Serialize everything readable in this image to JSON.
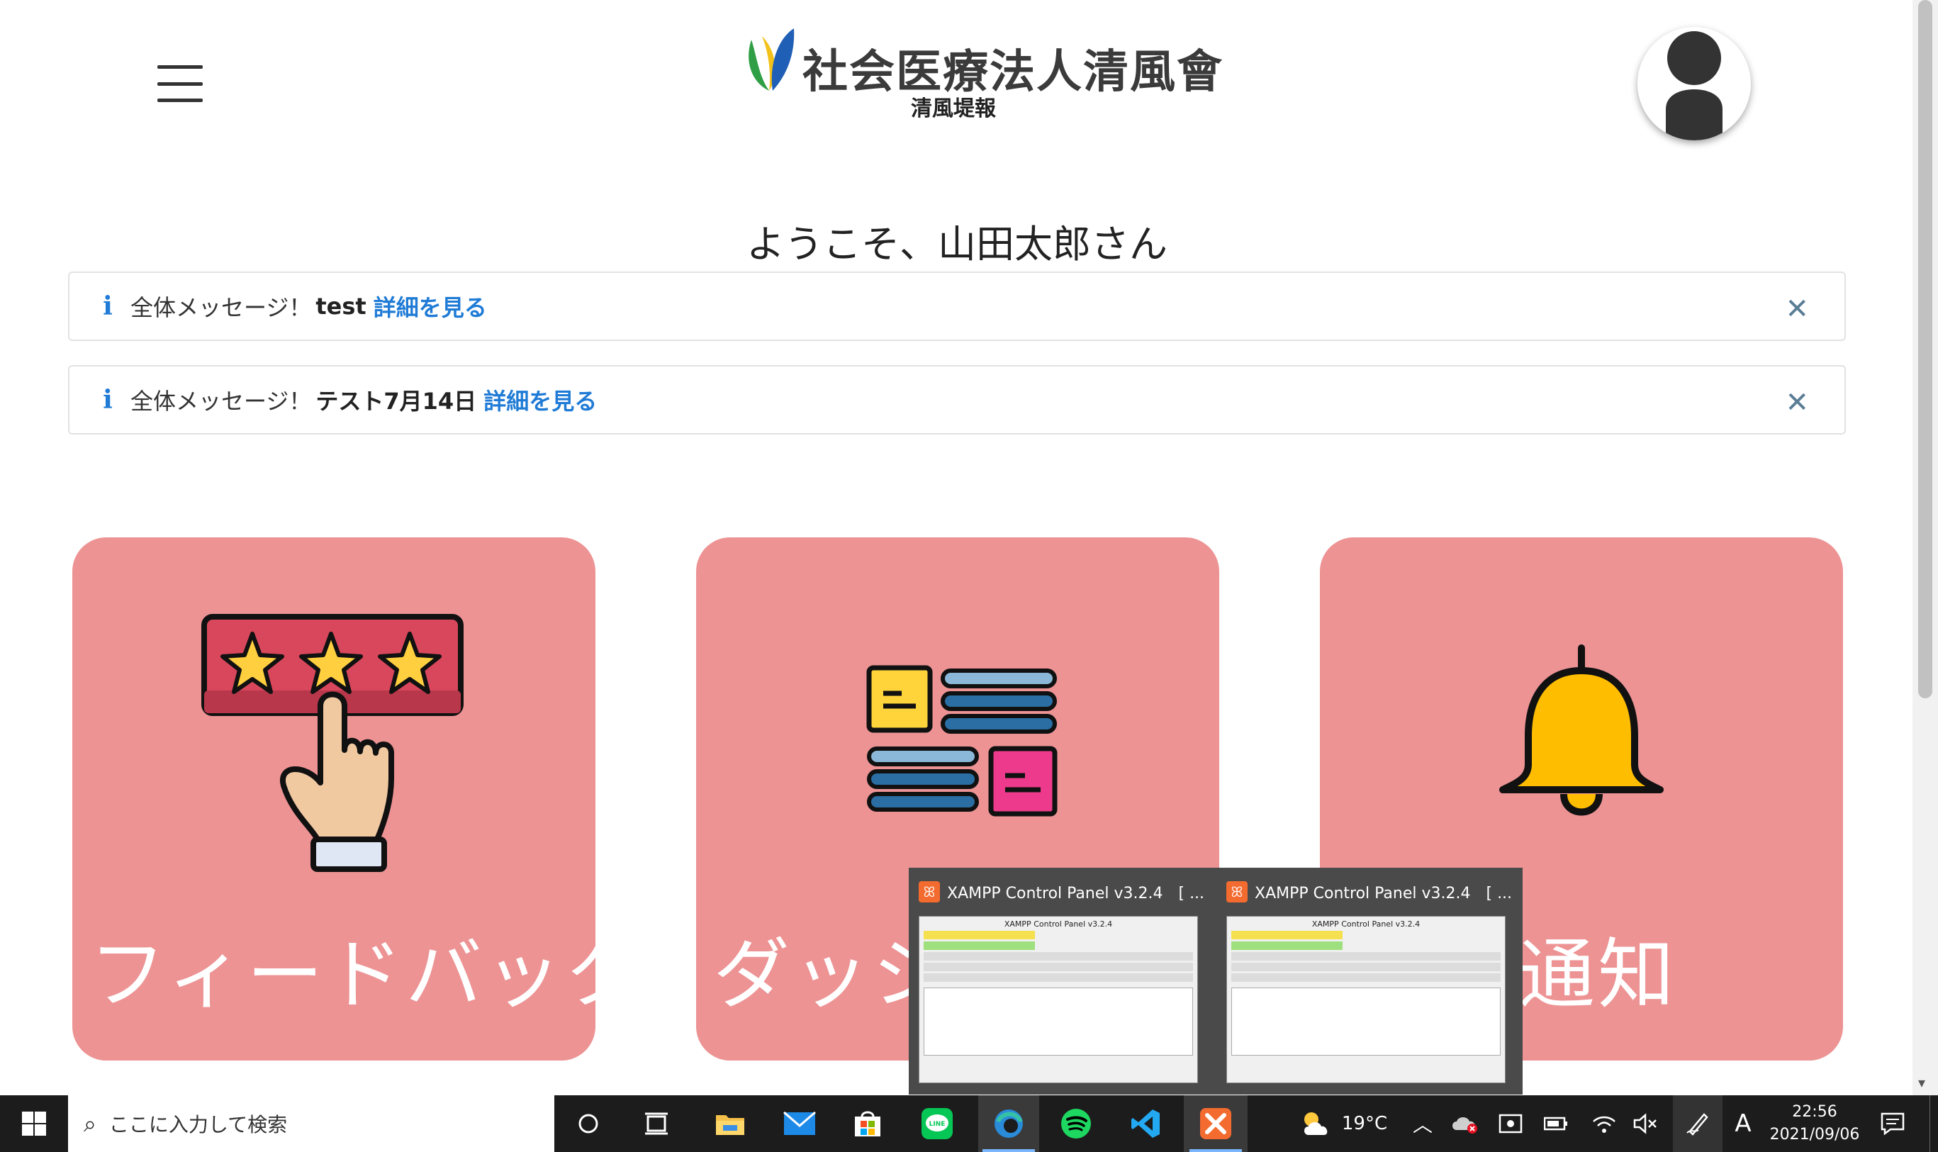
{
  "header": {
    "org_name": "社会医療法人清風會",
    "site_name": "清風堤報"
  },
  "welcome": "ようこそ、山田太郎さん",
  "alerts": [
    {
      "prefix": "全体メッセージ！",
      "title": "test",
      "link": "詳細を見る"
    },
    {
      "prefix": "全体メッセージ！",
      "title": "テスト7月14日",
      "link": "詳細を見る"
    }
  ],
  "cards": [
    {
      "label": "フィードバック",
      "icon": "rating-stars-hand-icon"
    },
    {
      "label": "ダッシ",
      "icon": "dashboard-notes-icon"
    },
    {
      "label": "通知",
      "icon": "bell-icon"
    }
  ],
  "thumbnails": [
    {
      "title": "XAMPP Control Panel v3.2.4　[ ...",
      "inner_title": "XAMPP Control Panel v3.2.4"
    },
    {
      "title": "XAMPP Control Panel v3.2.4　[ ...",
      "inner_title": "XAMPP Control Panel v3.2.4"
    }
  ],
  "taskbar": {
    "search_placeholder": "ここに入力して検索",
    "weather_temp": "19°C",
    "ime": "A",
    "time": "22:56",
    "date": "2021/09/06",
    "apps": [
      "task-view-icon",
      "file-explorer-icon",
      "mail-icon",
      "store-icon",
      "line-icon",
      "edge-icon",
      "spotify-icon",
      "vscode-icon",
      "xampp-icon"
    ]
  },
  "colors": {
    "card_bg": "#ed9394",
    "link": "#1f7bd6",
    "taskbar": "#1c1c1c"
  }
}
